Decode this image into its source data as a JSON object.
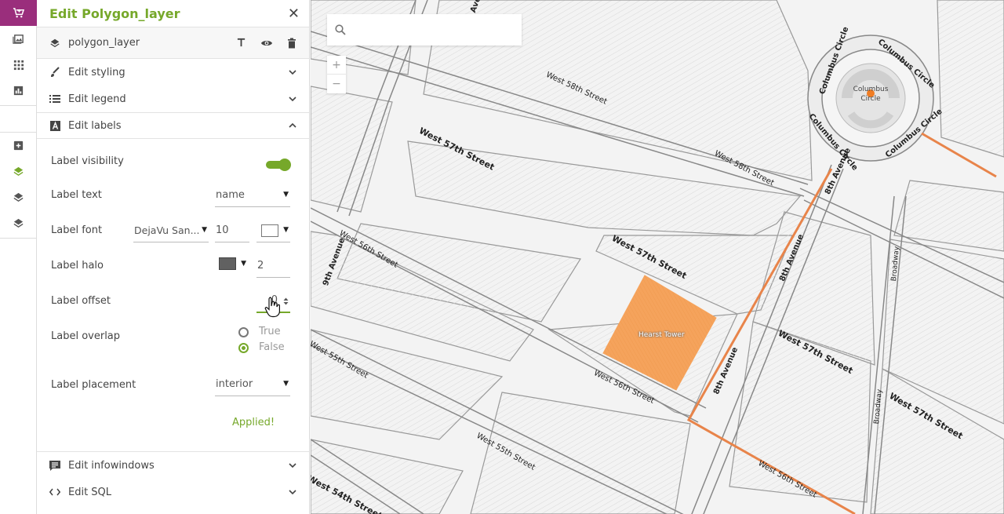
{
  "rail": {
    "icons": [
      "cart-icon",
      "image-icon",
      "grid-icon",
      "bar-chart-icon",
      "add-layer-icon",
      "layers-icon",
      "layers-icon",
      "layers-icon"
    ]
  },
  "panel": {
    "title": "Edit Polygon_layer",
    "layer_name": "polygon_layer",
    "sections": {
      "styling": "Edit styling",
      "legend": "Edit legend",
      "labels": "Edit labels",
      "infowindows": "Edit infowindows",
      "sql": "Edit SQL"
    },
    "labels_form": {
      "visibility_label": "Label visibility",
      "text_label": "Label text",
      "text_value": "name",
      "font_label": "Label font",
      "font_value": "DejaVu San...",
      "font_size": "10",
      "halo_label": "Label halo",
      "halo_size": "2",
      "offset_label": "Label offset",
      "offset_value": "0",
      "overlap_label": "Label overlap",
      "overlap_true": "True",
      "overlap_false": "False",
      "placement_label": "Label placement",
      "placement_value": "interior",
      "applied": "Applied!"
    },
    "colors": {
      "accent": "#76a82a",
      "font_color": "#ffffff",
      "halo_color": "#616161"
    }
  },
  "map": {
    "polygon_label": "Hearst Tower",
    "streets": {
      "w58_a": "West 58th Street",
      "w58_b": "West 58th Street",
      "w57_a": "West 57th Street",
      "w57_b": "West 57th Street",
      "w57_c": "West 57th Street",
      "w57_d": "West 57th Street",
      "w56_a": "West 56th Street",
      "w56_b": "West 56th Street",
      "w56_c": "West 56th Street",
      "w55_a": "West 55th Street",
      "w55_b": "West 55th Street",
      "w54": "West 54th Street",
      "ave9": "9th Avenue",
      "ave8_a": "8th Avenue",
      "ave8_b": "8th Avenue",
      "ave8_c": "8th Avenue",
      "broadway_a": "Broadway",
      "broadway_b": "Broadway",
      "cc1": "Columbus Circle",
      "cc2": "Columbus Circle",
      "cc3": "Columbus Circle",
      "cc4": "Columbus Circle",
      "cc5": "Columbus Circle",
      "ave_top": "Ave",
      "cc_center": "Columbus Circle"
    },
    "zoom_in": "+",
    "zoom_out": "−",
    "polygon_color": "#f5a35c",
    "route_color": "#e8844a"
  }
}
